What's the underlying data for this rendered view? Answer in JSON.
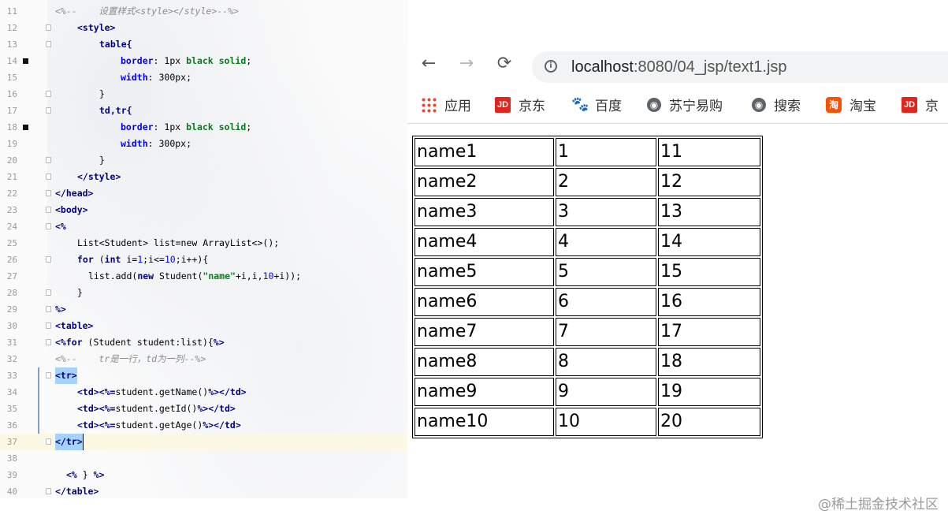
{
  "editor": {
    "lines": [
      {
        "n": "11"
      },
      {
        "n": "12"
      },
      {
        "n": "13"
      },
      {
        "n": "14"
      },
      {
        "n": "15"
      },
      {
        "n": "16"
      },
      {
        "n": "17"
      },
      {
        "n": "18"
      },
      {
        "n": "19"
      },
      {
        "n": "20"
      },
      {
        "n": "21"
      },
      {
        "n": "22"
      },
      {
        "n": "23"
      },
      {
        "n": "24"
      },
      {
        "n": "25"
      },
      {
        "n": "26"
      },
      {
        "n": "27"
      },
      {
        "n": "28"
      },
      {
        "n": "29"
      },
      {
        "n": "30"
      },
      {
        "n": "31"
      },
      {
        "n": "32"
      },
      {
        "n": "33"
      },
      {
        "n": "34"
      },
      {
        "n": "35"
      },
      {
        "n": "36"
      },
      {
        "n": "37"
      },
      {
        "n": "38"
      },
      {
        "n": "39"
      },
      {
        "n": "40"
      }
    ],
    "code": {
      "l11": "<%--    设置样式<style></style>--%>",
      "l12": "<style>",
      "l13": "table{",
      "l14a": "border",
      "l14b": ": 1px ",
      "l14c": "black solid",
      "l14d": ";",
      "l15a": "width",
      "l15b": ": 300px;",
      "l16": "}",
      "l17": "td,tr{",
      "l18a": "border",
      "l18b": ": 1px ",
      "l18c": "black solid",
      "l18d": ";",
      "l19a": "width",
      "l19b": ": 300px;",
      "l20": "}",
      "l21": "</style>",
      "l22": "</head>",
      "l23": "<body>",
      "l24": "<%",
      "l25": "List<Student> list=new ArrayList<>();",
      "l26a": "for",
      "l26b": " (",
      "l26c": "int",
      "l26d": " i=",
      "l26e": "1",
      "l26f": ";i<=",
      "l26g": "10",
      "l26h": ";i++){",
      "l27a": "list.add(",
      "l27b": "new",
      "l27c": " Student(",
      "l27d": "\"name\"",
      "l27e": "+i,i,",
      "l27f": "10",
      "l27g": "+i));",
      "l28": "}",
      "l29": "%>",
      "l30": "<table>",
      "l31a": "<%for",
      "l31b": " (Student student:list){",
      "l31c": "%>",
      "l32": "<%--    tr是一行，td为一列--%>",
      "l33": "<tr>",
      "l34a": "<td>",
      "l34b": "<%=",
      "l34c": "student.getName()",
      "l34d": "%>",
      "l34e": "</td>",
      "l35a": "<td>",
      "l35b": "<%=",
      "l35c": "student.getId()",
      "l35d": "%>",
      "l35e": "</td>",
      "l36a": "<td>",
      "l36b": "<%=",
      "l36c": "student.getAge()",
      "l36d": "%>",
      "l36e": "</td>",
      "l37": "</tr>",
      "l38": "",
      "l39a": "<%",
      "l39b": " } ",
      "l39c": "%>",
      "l40": "</table>"
    }
  },
  "browser": {
    "back": "←",
    "forward": "→",
    "reload": "⟳",
    "info": "i",
    "url_host": "localhost",
    "url_rest": ":8080/04_jsp/text1.jsp",
    "bookmarks": [
      {
        "label": "应用"
      },
      {
        "label": "京东"
      },
      {
        "label": "百度"
      },
      {
        "label": "苏宁易购"
      },
      {
        "label": "搜索"
      },
      {
        "label": "淘宝"
      },
      {
        "label": "京"
      }
    ],
    "jd_icon_text": "JD",
    "taobao_icon_text": "淘",
    "paw": "🐾",
    "globe": "◉"
  },
  "table": {
    "rows": [
      [
        "name1",
        "1",
        "11"
      ],
      [
        "name2",
        "2",
        "12"
      ],
      [
        "name3",
        "3",
        "13"
      ],
      [
        "name4",
        "4",
        "14"
      ],
      [
        "name5",
        "5",
        "15"
      ],
      [
        "name6",
        "6",
        "16"
      ],
      [
        "name7",
        "7",
        "17"
      ],
      [
        "name8",
        "8",
        "18"
      ],
      [
        "name9",
        "9",
        "19"
      ],
      [
        "name10",
        "10",
        "20"
      ]
    ]
  },
  "watermark": "@稀土掘金技术社区"
}
